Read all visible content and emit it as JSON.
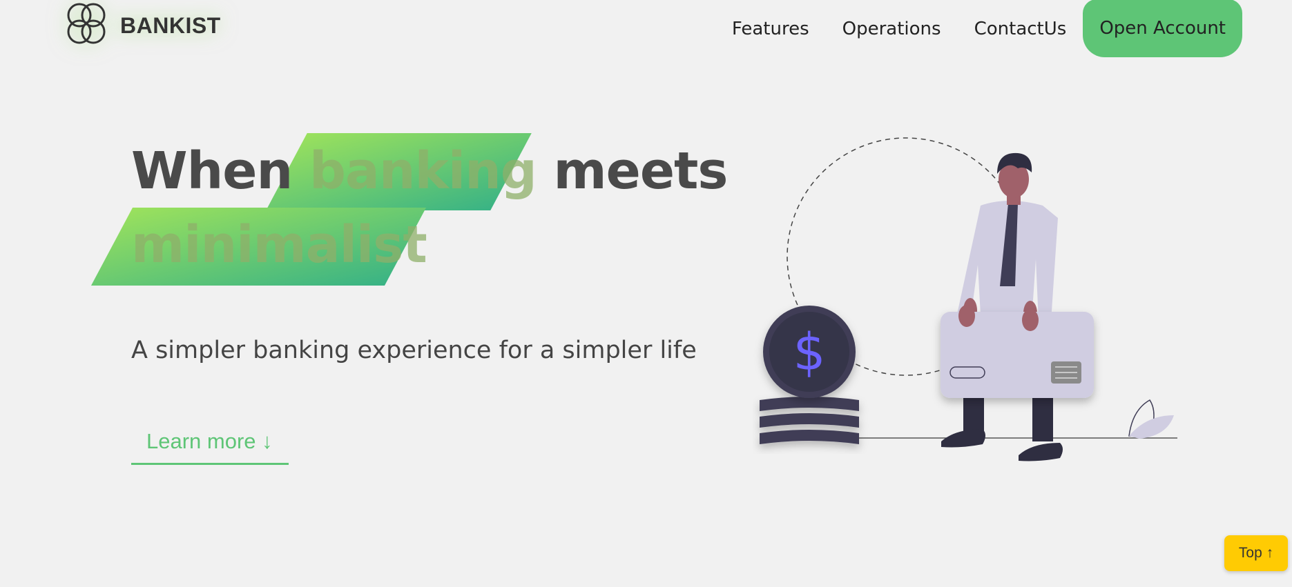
{
  "brand": {
    "name": "BANKIST",
    "icon": "bankist-logo-icon"
  },
  "nav": {
    "links": [
      "Features",
      "Operations",
      "ContactUs"
    ],
    "cta": "Open Account"
  },
  "hero": {
    "title_prefix": "When",
    "title_highlight1": "banking",
    "title_middle": "meets",
    "title_highlight2": "minimalist",
    "subtitle": "A simpler banking experience for a simpler life",
    "learn_more": "Learn more ↓",
    "illustration": "person-with-credit-card-and-coins-illustration"
  },
  "top_button": "Top ↑",
  "colors": {
    "primary": "#5ec576",
    "gradient_start": "#9be15d",
    "gradient_end": "#39b385",
    "top_button": "#ffcb03",
    "background": "#f1f1f1"
  }
}
